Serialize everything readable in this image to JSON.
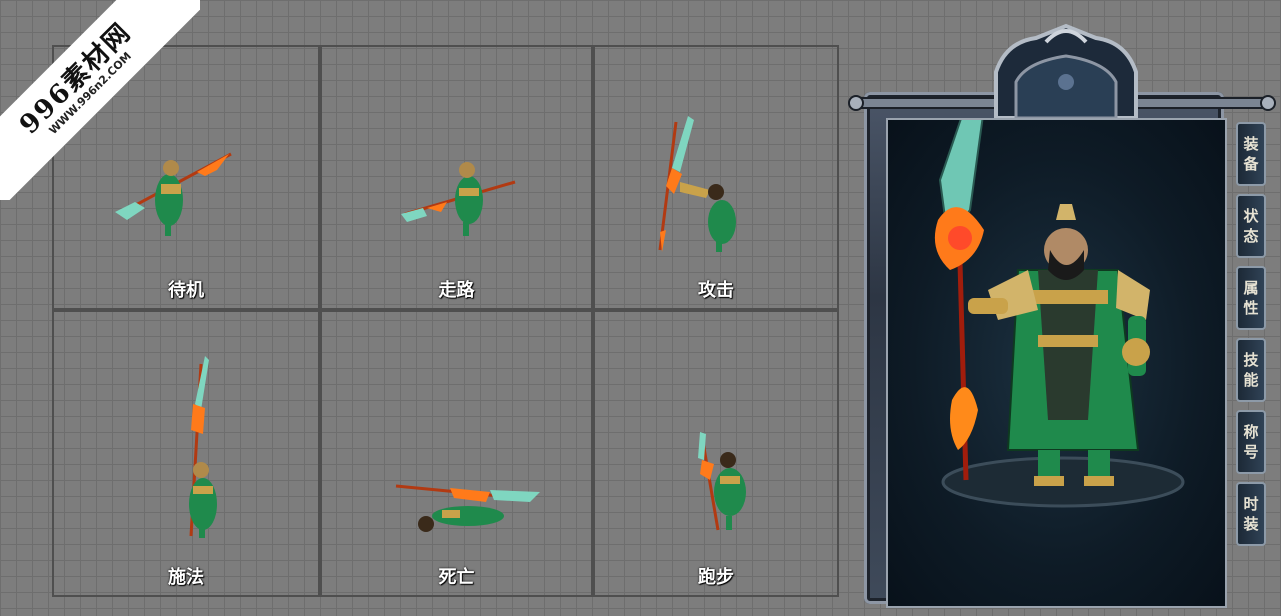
{
  "watermark": {
    "main": "996素材网",
    "sub": "WWW.996n2.COM"
  },
  "animations": [
    {
      "label": "待机",
      "pose": "idle"
    },
    {
      "label": "走路",
      "pose": "walk"
    },
    {
      "label": "攻击",
      "pose": "attack"
    },
    {
      "label": "施法",
      "pose": "cast"
    },
    {
      "label": "死亡",
      "pose": "death"
    },
    {
      "label": "跑步",
      "pose": "run"
    }
  ],
  "panel": {
    "tabs": [
      {
        "label": "装备"
      },
      {
        "label": "状态"
      },
      {
        "label": "属性"
      },
      {
        "label": "技能"
      },
      {
        "label": "称号"
      },
      {
        "label": "时装"
      }
    ]
  },
  "colors": {
    "background": "#7d7d7d",
    "gridline": "#6e6e6e",
    "cell_border": "#4f4f4f",
    "armor_green": "#1f8a4c",
    "flame": "#ff7a1a",
    "blade": "#7fd6c0",
    "panel_dark": "#0e1b26"
  }
}
